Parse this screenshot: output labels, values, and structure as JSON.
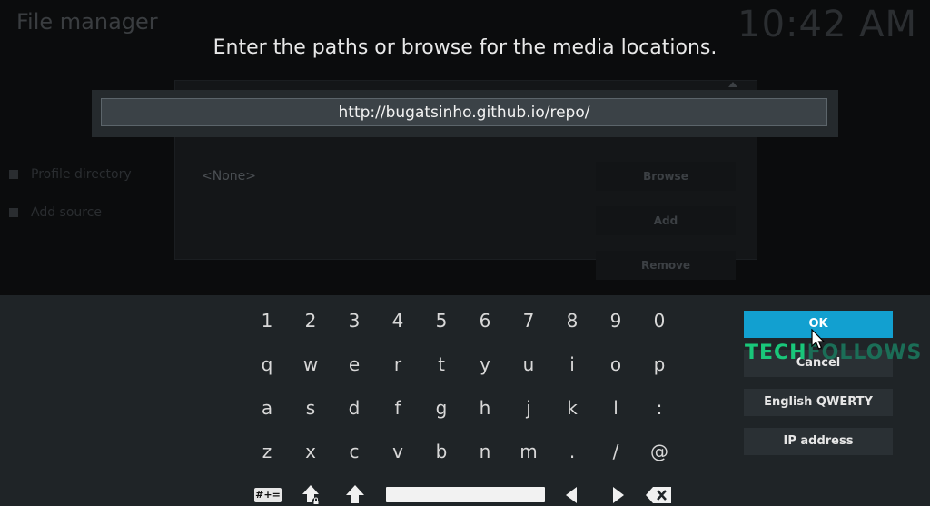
{
  "background": {
    "title": "File manager",
    "clock": "10:42 AM",
    "sidebar_items": [
      "Profile directory",
      "Add source"
    ],
    "source_list_empty": "<None>",
    "buttons": [
      "Browse",
      "Add",
      "Remove"
    ]
  },
  "dialog": {
    "heading": "Enter the paths or browse for the media locations.",
    "url_value": "http://bugatsinho.github.io/repo/"
  },
  "keyboard": {
    "rows": [
      [
        "1",
        "2",
        "3",
        "4",
        "5",
        "6",
        "7",
        "8",
        "9",
        "0"
      ],
      [
        "q",
        "w",
        "e",
        "r",
        "t",
        "y",
        "u",
        "i",
        "o",
        "p"
      ],
      [
        "a",
        "s",
        "d",
        "f",
        "g",
        "h",
        "j",
        "k",
        "l",
        ":"
      ],
      [
        "z",
        "x",
        "c",
        "v",
        "b",
        "n",
        "m",
        ".",
        "/",
        "@"
      ]
    ],
    "symbols_key": "#+=",
    "side_buttons": {
      "ok": "OK",
      "cancel": "Cancel",
      "layout": "English QWERTY",
      "ip": "IP address"
    },
    "accent_color": "#12a0d0"
  },
  "watermark": {
    "part1": "TECH",
    "part2": "FOLLOWS"
  }
}
